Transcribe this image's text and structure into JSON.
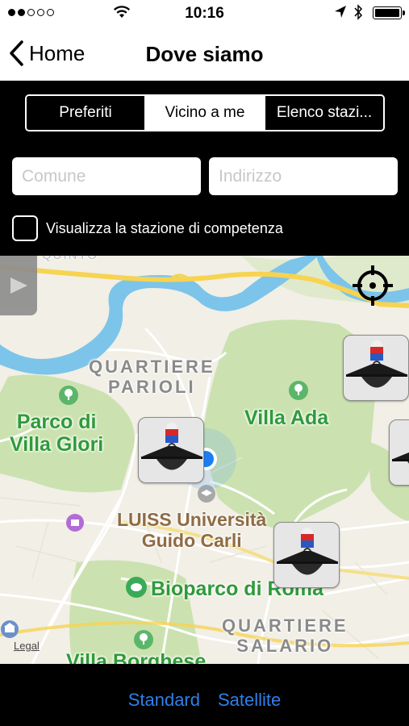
{
  "status_bar": {
    "time": "10:16",
    "signal_dots_filled": 2,
    "signal_dots_total": 5,
    "battery_level": 1.0
  },
  "nav": {
    "back_label": "Home",
    "title": "Dove siamo"
  },
  "segments": {
    "items": [
      "Preferiti",
      "Vicino a me",
      "Elenco stazi..."
    ],
    "selected": "Vicino a me"
  },
  "search": {
    "comune_placeholder": "Comune",
    "indirizzo_placeholder": "Indirizzo"
  },
  "filter": {
    "label": "Visualizza la stazione di competenza",
    "checked": false
  },
  "map": {
    "labels": {
      "quartiere_parioli": "QUARTIERE\nPARIOLI",
      "parco_villa_glori": "Parco di\nVilla Glori",
      "villa_ada": "Villa Ada",
      "luiss": "LUISS Università\nGuido Carli",
      "bioparco": "Bioparco di Roma",
      "quartiere_salario": "QUARTIERE\nSALARIO",
      "villa_borghese": "Villa Borghese",
      "quinto": "QUINTO",
      "legal": "Legal"
    },
    "colors": {
      "water": "#7cc4ea",
      "park": "#cbe2b0",
      "highway": "#f7d352",
      "land": "#f1efe6"
    }
  },
  "bottom": {
    "standard_label": "Standard",
    "satellite_label": "Satellite",
    "accent_color": "#2f7fe8"
  }
}
